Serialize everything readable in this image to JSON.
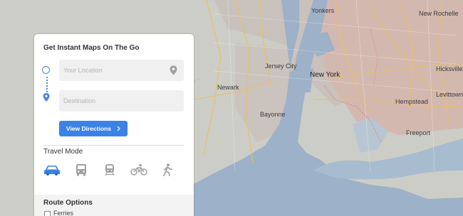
{
  "map": {
    "labels": {
      "new_york": "New York",
      "jersey_city": "Jersey City",
      "bayonne": "Bayonne",
      "newark": "Newark",
      "new_rochelle": "New Rochelle",
      "yonkers": "Yonkers",
      "hempstead": "Hempstead",
      "freeport": "Freeport",
      "levittown": "Levittown",
      "hicksville": "Hicksville"
    },
    "colors": {
      "land": "#cdcdc7",
      "water": "#9db1c8",
      "city": "#d3b8b0",
      "road": "#e6c06a"
    }
  },
  "panel": {
    "title": "Get Instant Maps On The Go",
    "origin_placeholder": "Your Location",
    "destination_placeholder": "Destination",
    "view_directions": "View Directions",
    "travel_mode_label": "Travel Mode",
    "modes": [
      "car-icon",
      "bus-icon",
      "train-icon",
      "bike-icon",
      "walk-icon"
    ],
    "selected_mode": "car",
    "route_options_label": "Route Options",
    "ferries_label": "Ferries",
    "accent_color": "#3b82e8"
  }
}
